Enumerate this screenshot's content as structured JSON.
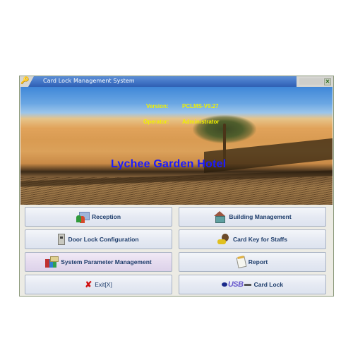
{
  "window": {
    "title": "Card Lock Management System",
    "icons": {
      "app": "keys-icon",
      "close": "close-icon"
    }
  },
  "banner": {
    "version_label": "Version:",
    "version_value": "PCLMS-V9.27",
    "operator_label": "Operator:",
    "operator_value": "Administrator",
    "hotel_name": "Lychee Garden Hotel"
  },
  "buttons": [
    {
      "id": "reception",
      "label": "Reception",
      "icon": "reception-icon"
    },
    {
      "id": "building-management",
      "label": "Building Management",
      "icon": "house-icon"
    },
    {
      "id": "door-lock-configuration",
      "label": "Door Lock Configuration",
      "icon": "door-lock-icon"
    },
    {
      "id": "card-key-for-staffs",
      "label": "Card Key for Staffs",
      "icon": "staff-key-icon"
    },
    {
      "id": "system-parameter-management",
      "label": "System Parameter Management",
      "icon": "books-icon",
      "active": true
    },
    {
      "id": "report",
      "label": "Report",
      "icon": "report-icon"
    },
    {
      "id": "exit",
      "label": "Exit[X]",
      "icon": "x-icon"
    },
    {
      "id": "card-lock",
      "label": "Card Lock",
      "icon": "usb-icon"
    }
  ],
  "colors": {
    "title_bar": "#3f72c4",
    "info_text": "#f0f000",
    "hotel_name": "#1a1aff",
    "button_text": "#1e3d6b",
    "exit_icon": "#d01010"
  }
}
